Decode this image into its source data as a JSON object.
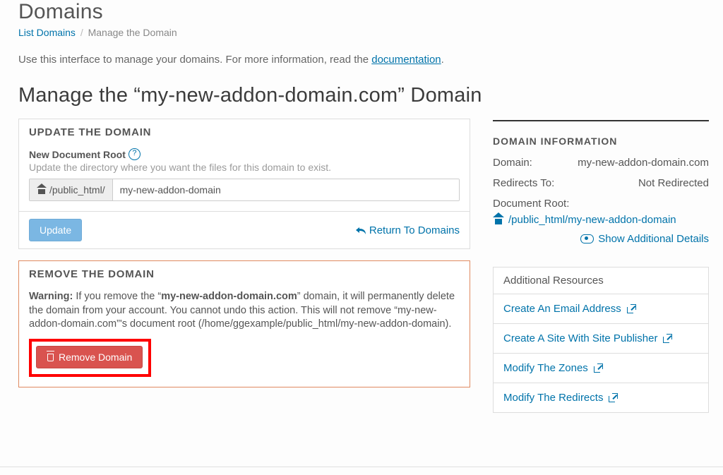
{
  "page_title": "Domains",
  "breadcrumb": {
    "list": "List Domains",
    "current": "Manage the Domain"
  },
  "intro": {
    "pre": "Use this interface to manage your domains. For more information, read the ",
    "link": "documentation",
    "post": "."
  },
  "manage_heading": "Manage the “my-new-addon-domain.com” Domain",
  "update_panel": {
    "title": "UPDATE THE DOMAIN",
    "field_label": "New Document Root",
    "hint": "Update the directory where you want the files for this domain to exist.",
    "prefix": "/public_html/",
    "value": "my-new-addon-domain",
    "update_btn": "Update",
    "return_link": "Return To Domains"
  },
  "remove_panel": {
    "title": "REMOVE THE DOMAIN",
    "warn_label": "Warning:",
    "warn_pre": " If you remove the “",
    "warn_domain": "my-new-addon-domain.com",
    "warn_post": "” domain, it will permanently delete the domain from your account. You cannot undo this action. This will not remove “my-new-addon-domain.com”'s document root (/home/ggexample/public_html/my-new-addon-domain).",
    "remove_btn": "Remove Domain"
  },
  "info": {
    "title": "DOMAIN INFORMATION",
    "rows": {
      "domain_l": "Domain:",
      "domain_v": "my-new-addon-domain.com",
      "redir_l": "Redirects To:",
      "redir_v": "Not Redirected",
      "docroot_l": "Document Root:",
      "docroot_v": "/public_html/my-new-addon-domain"
    },
    "show_details": "Show Additional Details"
  },
  "resources": {
    "title": "Additional Resources",
    "items": [
      "Create An Email Address",
      "Create A Site With Site Publisher",
      "Modify The Zones",
      "Modify The Redirects"
    ]
  }
}
